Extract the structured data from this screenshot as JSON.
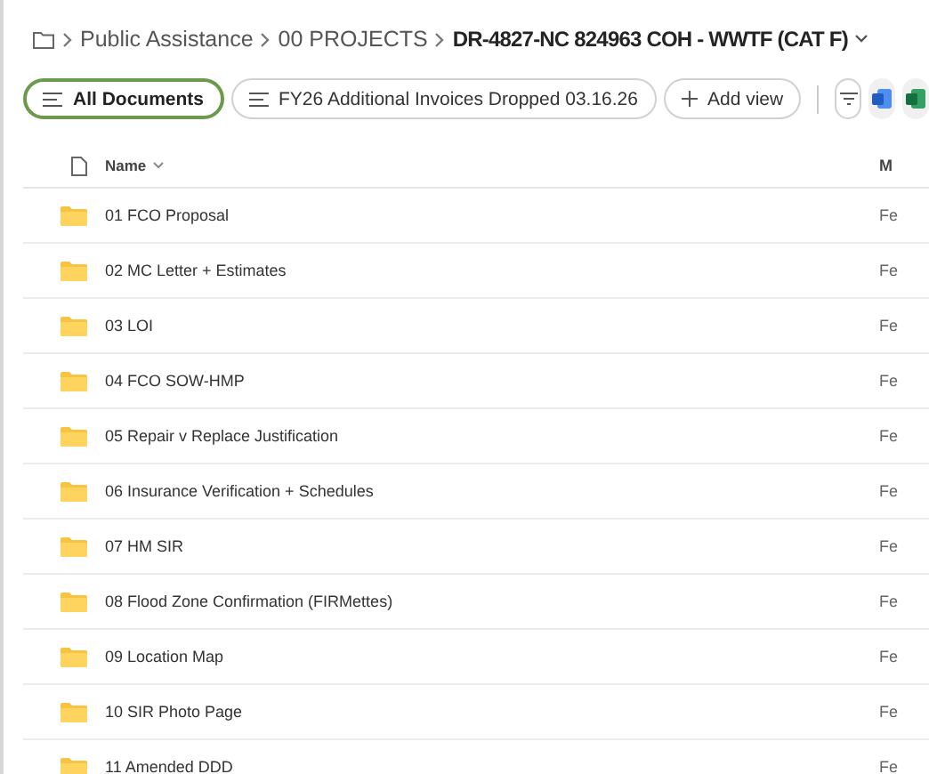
{
  "breadcrumb": [
    "Public Assistance",
    "00 PROJECTS",
    "DR-4827-NC 824963 COH - WWTF (CAT F)"
  ],
  "views": [
    {
      "label": "All Documents",
      "selected": true
    },
    {
      "label": "FY26 Additional Invoices Dropped 03.16.26",
      "selected": false
    }
  ],
  "add_view": "Add view",
  "columns": [
    "Name",
    "M"
  ],
  "rows": [
    {
      "name": "01 FCO Proposal",
      "column_2": "Fe"
    },
    {
      "name": "02 MC Letter + Estimates",
      "column_2": "Fe"
    },
    {
      "name": "03 LOI",
      "column_2": "Fe"
    },
    {
      "name": "04 FCO SOW-HMP",
      "column_2": "Fe"
    },
    {
      "name": "05 Repair v Replace Justification",
      "column_2": "Fe"
    },
    {
      "name": "06 Insurance Verification + Schedules",
      "column_2": "Fe"
    },
    {
      "name": "07 HM SIR",
      "column_2": "Fe"
    },
    {
      "name": "08 Flood Zone Confirmation (FIRMettes)",
      "column_2": "Fe"
    },
    {
      "name": "09 Location Map",
      "column_2": "Fe"
    },
    {
      "name": "10 SIR Photo Page",
      "column_2": "Fe"
    },
    {
      "name": "11 Amended DDD",
      "column_2": "Fe"
    }
  ]
}
